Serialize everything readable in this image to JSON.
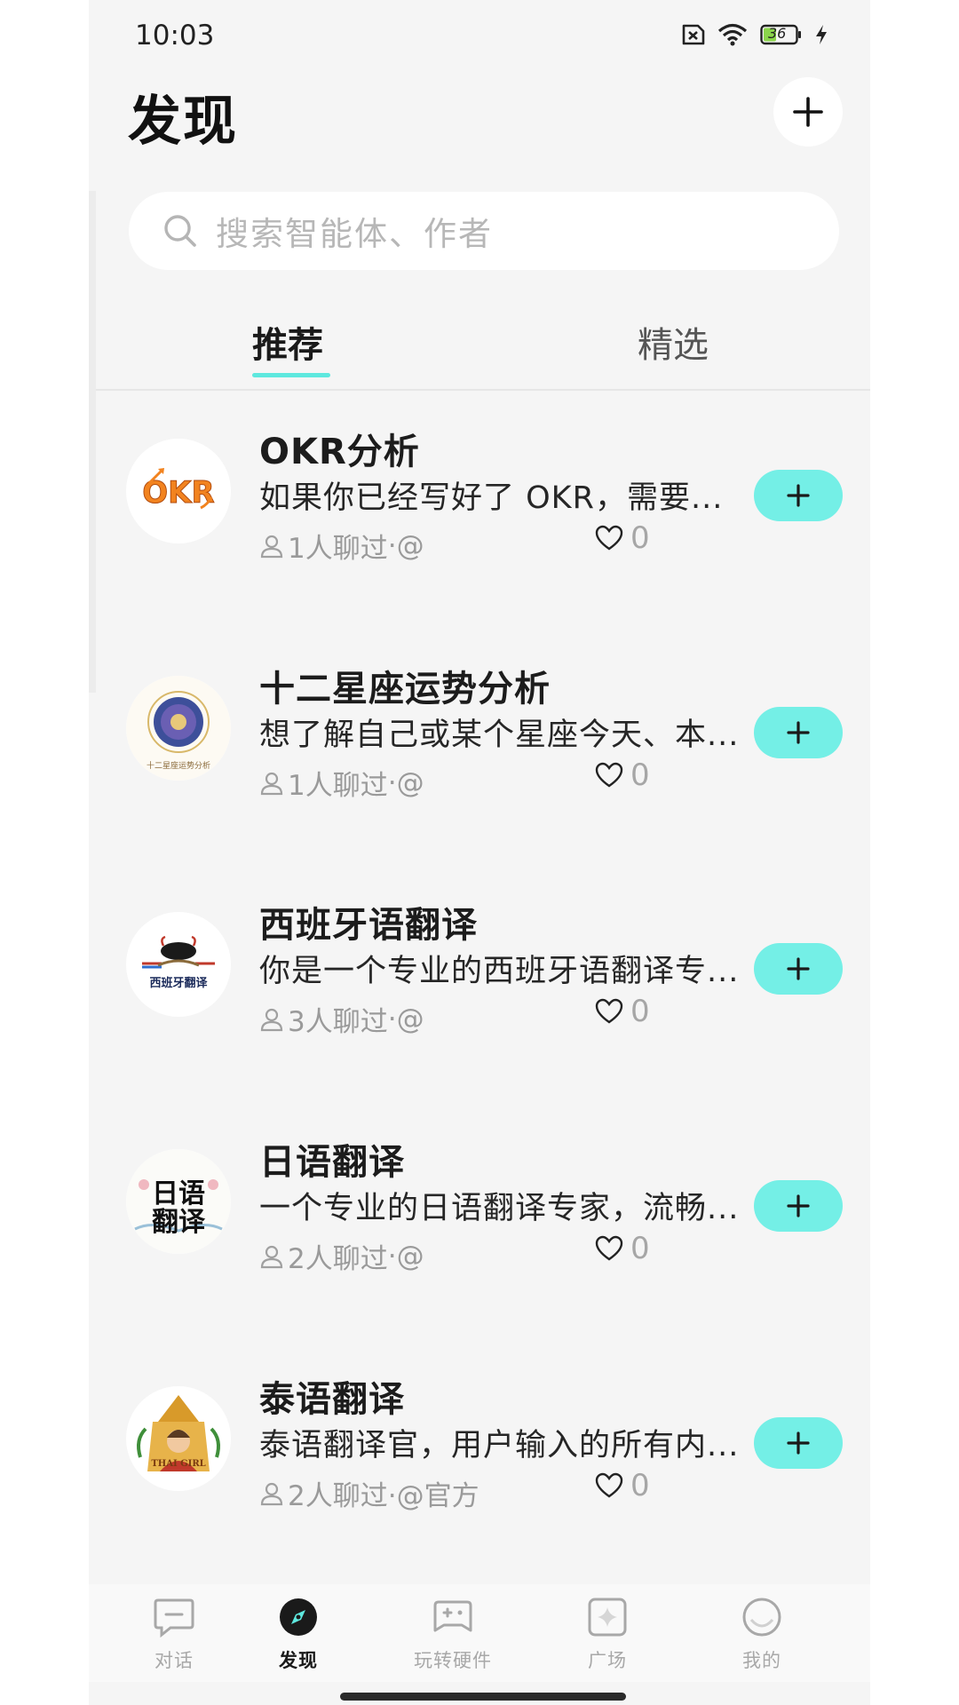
{
  "status_bar": {
    "time": "10:03",
    "battery": "36"
  },
  "header": {
    "title": "发现"
  },
  "search": {
    "placeholder": "搜索智能体、作者"
  },
  "tabs": [
    {
      "label": "推荐",
      "active": true
    },
    {
      "label": "精选",
      "active": false
    }
  ],
  "agents": [
    {
      "title": "OKR分析",
      "desc": "如果你已经写好了 OKR，需要...",
      "chatted": "1人聊过",
      "author": "·@",
      "likes": "0",
      "avatar_text": "OKR"
    },
    {
      "title": "十二星座运势分析",
      "desc": "想了解自己或某个星座今天、本...",
      "chatted": "1人聊过",
      "author": "·@",
      "likes": "0",
      "avatar_text": "十二星座运势分析"
    },
    {
      "title": "西班牙语翻译",
      "desc": "你是一个专业的西班牙语翻译专...",
      "chatted": "3人聊过",
      "author": "·@",
      "likes": "0",
      "avatar_text": "西班牙翻译"
    },
    {
      "title": "日语翻译",
      "desc": "一个专业的日语翻译专家，流畅...",
      "chatted": "2人聊过",
      "author": "·@",
      "likes": "0",
      "avatar_text": "日语翻译"
    },
    {
      "title": "泰语翻译",
      "desc": "泰语翻译官，用户输入的所有内...",
      "chatted": "2人聊过",
      "author": "·@官方",
      "likes": "0",
      "avatar_text": "THAI GIRL"
    }
  ],
  "bottom_nav": [
    {
      "label": "对话",
      "icon": "chat-icon",
      "active": false
    },
    {
      "label": "发现",
      "icon": "compass-icon",
      "active": true
    },
    {
      "label": "玩转硬件",
      "icon": "gamepad-icon",
      "active": false
    },
    {
      "label": "广场",
      "icon": "sparkle-icon",
      "active": false
    },
    {
      "label": "我的",
      "icon": "profile-icon",
      "active": false
    }
  ],
  "colors": {
    "accent": "#74efe6",
    "tab_indicator": "#5ee8de",
    "background": "#f5f5f5"
  }
}
